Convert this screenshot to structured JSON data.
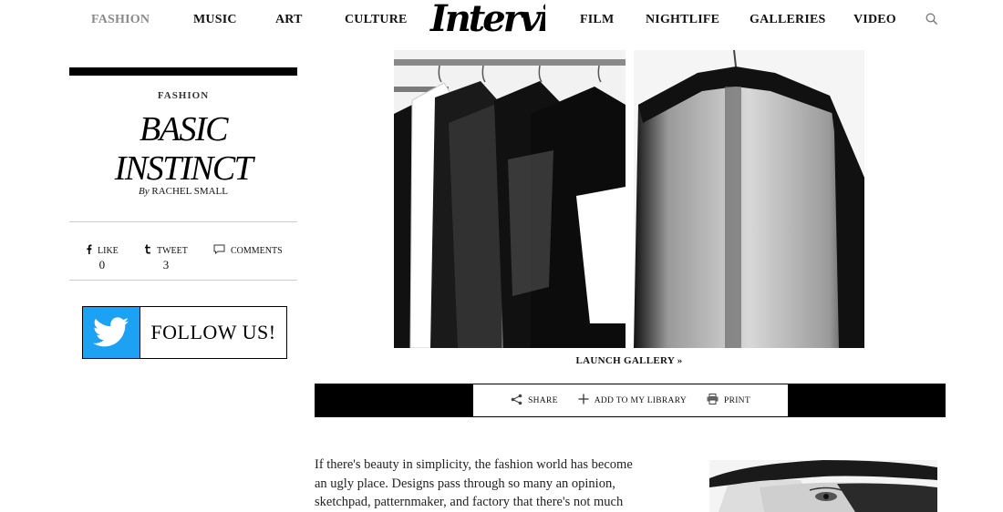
{
  "nav": {
    "items": [
      {
        "label": "FASHION",
        "active": true
      },
      {
        "label": "MUSIC",
        "active": false
      },
      {
        "label": "ART",
        "active": false
      },
      {
        "label": "CULTURE",
        "active": false
      },
      {
        "label": "FILM",
        "active": false
      },
      {
        "label": "NIGHTLIFE",
        "active": false
      },
      {
        "label": "GALLERIES",
        "active": false
      },
      {
        "label": "VIDEO",
        "active": false
      }
    ],
    "logo_text": "Interview"
  },
  "article": {
    "section": "FASHION",
    "title_line1": "BASIC",
    "title_line2": "INSTINCT",
    "byline_prefix": "By",
    "author": "RACHEL SMALL"
  },
  "social": {
    "like_label": "LIKE",
    "like_count": "0",
    "tweet_label": "TWEET",
    "tweet_count": "3",
    "comments_label": "COMMENTS"
  },
  "follow": {
    "label": "FOLLOW US!"
  },
  "gallery": {
    "launch_label": "LAUNCH GALLERY »"
  },
  "share_bar": {
    "share_label": "SHARE",
    "library_label": "ADD TO MY LIBRARY",
    "print_label": "PRINT"
  },
  "body": {
    "line1": "If there's beauty in simplicity, the fashion world has become",
    "line2": "an ugly place. Designs pass through so many an opinion,",
    "line3": "sketchpad, patternmaker, and factory that there's not much"
  },
  "colors": {
    "twitter_blue": "#1da1f2",
    "nav_active": "#8a8a8a"
  }
}
